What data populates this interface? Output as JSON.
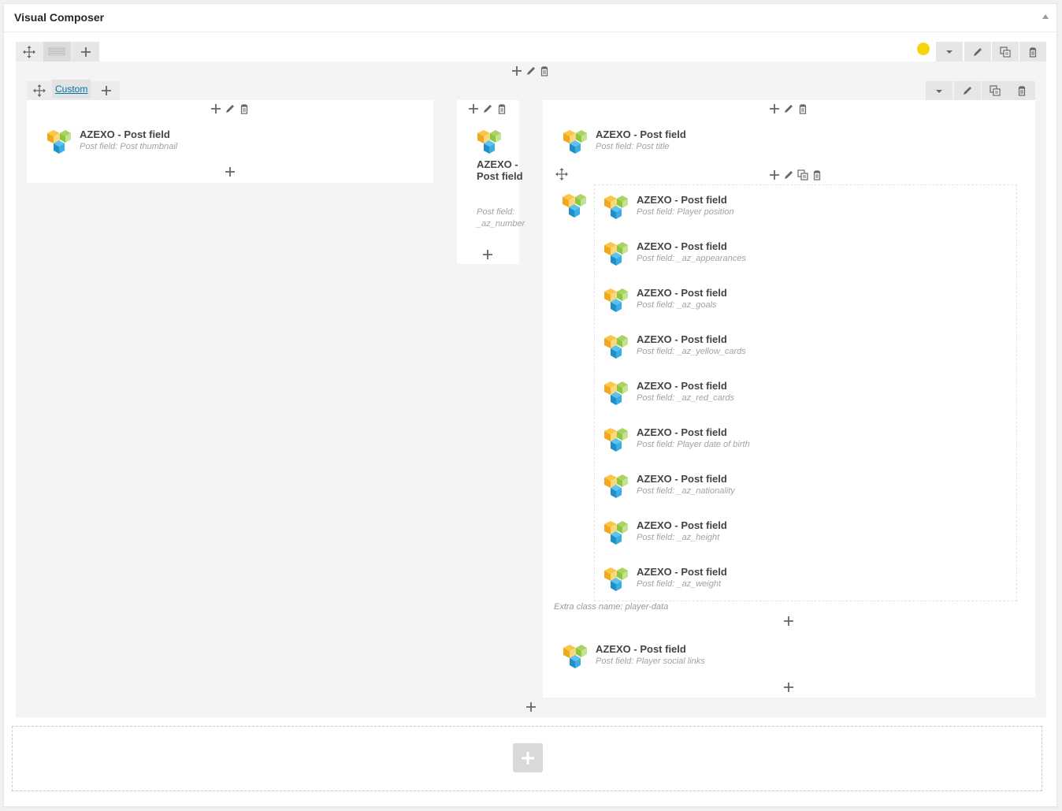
{
  "panel": {
    "title": "Visual Composer"
  },
  "colors": {
    "status_dot": "#f5d50f",
    "link": "#0073aa",
    "logo": [
      "#f7b733",
      "#8dc63f",
      "#27a9e1"
    ]
  },
  "row": {
    "controls": {
      "move": "move-icon",
      "layout": "layout-icon",
      "add": "plus-icon",
      "toggle": "caret-down-icon",
      "edit": "pencil-icon",
      "clone": "clone-icon",
      "delete": "trash-icon"
    }
  },
  "inner_row": {
    "tab_label": "Custom"
  },
  "columns": [
    {
      "elements": [
        {
          "title": "AZEXO - Post field",
          "subtitle": "Post field: Post thumbnail"
        }
      ]
    },
    {
      "elements": [
        {
          "title": "AZEXO - Post field",
          "subtitle": "Post field: _az_number"
        }
      ]
    },
    {
      "elements": [
        {
          "title": "AZEXO - Post field",
          "subtitle": "Post field: Post title"
        }
      ],
      "container": {
        "extra_class": "Extra class name: player-data",
        "elements": [
          {
            "title": "AZEXO - Post field",
            "subtitle": "Post field: Player position"
          },
          {
            "title": "AZEXO - Post field",
            "subtitle": "Post field: _az_appearances"
          },
          {
            "title": "AZEXO - Post field",
            "subtitle": "Post field: _az_goals"
          },
          {
            "title": "AZEXO - Post field",
            "subtitle": "Post field: _az_yellow_cards"
          },
          {
            "title": "AZEXO - Post field",
            "subtitle": "Post field: _az_red_cards"
          },
          {
            "title": "AZEXO - Post field",
            "subtitle": "Post field: Player date of birth"
          },
          {
            "title": "AZEXO - Post field",
            "subtitle": "Post field: _az_nationality"
          },
          {
            "title": "AZEXO - Post field",
            "subtitle": "Post field: _az_height"
          },
          {
            "title": "AZEXO - Post field",
            "subtitle": "Post field: _az_weight"
          }
        ]
      },
      "after": {
        "title": "AZEXO - Post field",
        "subtitle": "Post field: Player social links"
      }
    }
  ]
}
